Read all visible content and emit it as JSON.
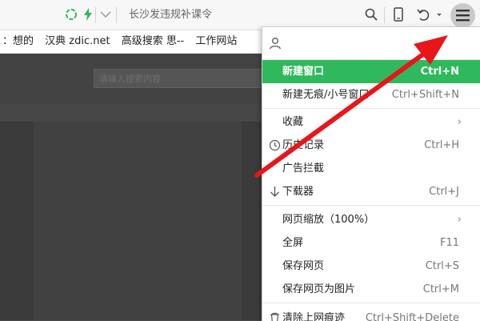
{
  "toolbar": {
    "address_text": "长沙发违规补课令",
    "icons": [
      "refresh-icon",
      "lightning-icon",
      "chevron-down-icon",
      "search-icon",
      "mobile-icon",
      "undo-icon",
      "menu-icon"
    ]
  },
  "bookmarks": [
    "：想的",
    "汉典 zdic.net",
    "高级搜索 思--",
    "工作网站"
  ],
  "page": {
    "search_placeholder": "请输入搜索内容"
  },
  "menu": {
    "user_icon": "user-icon",
    "items": [
      {
        "label": "新建窗口",
        "shortcut": "Ctrl+N",
        "active": true
      },
      {
        "label": "新建无痕/小号窗口",
        "shortcut": "Ctrl+Shift+N"
      },
      {
        "label": "收藏",
        "submenu": true
      },
      {
        "label": "历史记录",
        "shortcut": "Ctrl+H",
        "icon": "clock-icon"
      },
      {
        "label": "广告拦截"
      },
      {
        "label": "下载器",
        "shortcut": "Ctrl+J",
        "icon": "download-icon"
      },
      {
        "label": "网页缩放（100%）",
        "submenu": true
      },
      {
        "label": "全屏",
        "shortcut": "F11"
      },
      {
        "label": "保存网页",
        "shortcut": "Ctrl+S"
      },
      {
        "label": "保存网页为图片",
        "shortcut": "Ctrl+M"
      },
      {
        "label": "清除上网痕迹",
        "shortcut": "Ctrl+Shift+Delete",
        "icon": "trash-icon"
      }
    ]
  },
  "colors": {
    "accent": "#2fb95c",
    "arrow": "#e8151b"
  }
}
